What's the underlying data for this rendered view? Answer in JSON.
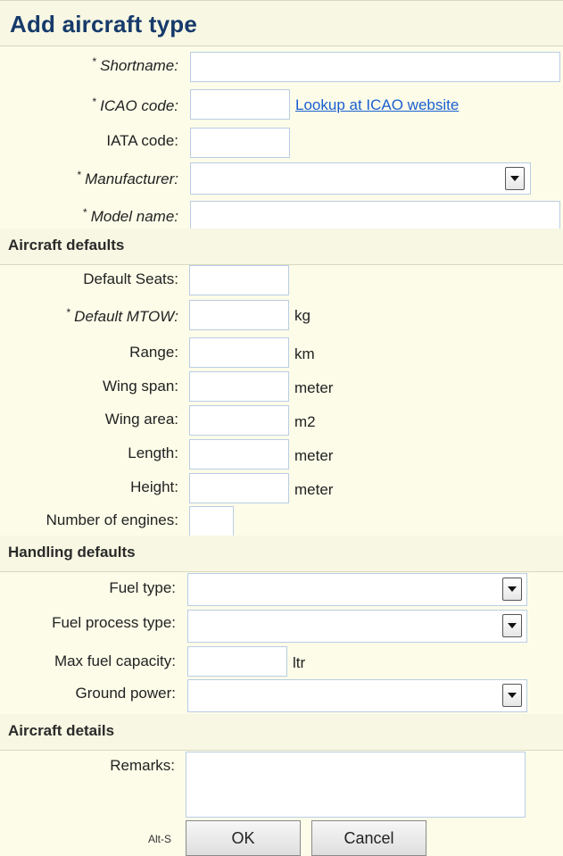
{
  "title": "Add aircraft type",
  "fields": {
    "shortname": {
      "label": "Shortname:",
      "value": ""
    },
    "icao": {
      "label": "ICAO code:",
      "value": ""
    },
    "icao_link": "Lookup at ICAO website",
    "iata": {
      "label": "IATA code:",
      "value": ""
    },
    "manufacturer": {
      "label": "Manufacturer:",
      "value": ""
    },
    "model": {
      "label": "Model name:",
      "value": ""
    }
  },
  "required_mark": "*",
  "aircraft_defaults": {
    "heading": "Aircraft defaults",
    "seats": {
      "label": "Default Seats:",
      "value": ""
    },
    "mtow": {
      "label": "Default MTOW:",
      "unit": "kg",
      "value": ""
    },
    "range": {
      "label": "Range:",
      "unit": "km",
      "value": ""
    },
    "wing_span": {
      "label": "Wing span:",
      "unit": "meter",
      "value": ""
    },
    "wing_area": {
      "label": "Wing area:",
      "unit": "m2",
      "value": ""
    },
    "length": {
      "label": "Length:",
      "unit": "meter",
      "value": ""
    },
    "height": {
      "label": "Height:",
      "unit": "meter",
      "value": ""
    },
    "engines": {
      "label": "Number of engines:",
      "value": ""
    }
  },
  "handling_defaults": {
    "heading": "Handling defaults",
    "fuel_type": {
      "label": "Fuel type:",
      "value": ""
    },
    "fuel_process": {
      "label": "Fuel process type:",
      "value": ""
    },
    "max_fuel": {
      "label": "Max fuel capacity:",
      "unit": "ltr",
      "value": ""
    },
    "ground_power": {
      "label": "Ground power:",
      "value": ""
    }
  },
  "aircraft_details": {
    "heading": "Aircraft details",
    "remarks": {
      "label": "Remarks:",
      "value": ""
    }
  },
  "buttons": {
    "shortcut_hint": "Alt-S",
    "ok": "OK",
    "cancel": "Cancel"
  },
  "icons": {
    "dropdown": "chevron-down-icon"
  }
}
